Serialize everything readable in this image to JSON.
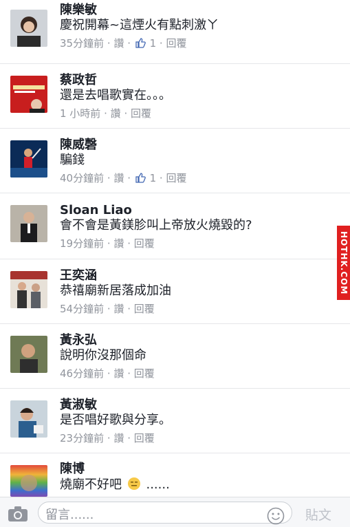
{
  "comments": [
    {
      "name": "陳樂敏",
      "text": "慶祝開幕~這煙火有點刺激ㄚ",
      "time": "35分鐘前",
      "like": "讚",
      "like_count": "1",
      "reply": "回覆",
      "avatar": "person-photo"
    },
    {
      "name": "蔡政哲",
      "text": "還是去唱歌實在。。。",
      "time": "1 小時前",
      "like": "讚",
      "like_count": "",
      "reply": "回覆",
      "avatar": "book-cover-photo"
    },
    {
      "name": "陳威磬",
      "text": "騙錢",
      "time": "40分鐘前",
      "like": "讚",
      "like_count": "1",
      "reply": "回覆",
      "avatar": "tennis-player-photo"
    },
    {
      "name": "Sloan Liao",
      "text": "會不會是黃鎂胗叫上帝放火燒毀的?",
      "time": "19分鐘前",
      "like": "讚",
      "like_count": "",
      "reply": "回覆",
      "avatar": "man-in-suit-photo"
    },
    {
      "name": "王奕涵",
      "text": "恭禧廟新居落成加油",
      "time": "54分鐘前",
      "like": "讚",
      "like_count": "",
      "reply": "回覆",
      "avatar": "people-photo"
    },
    {
      "name": "黃永弘",
      "text": "說明你沒那個命",
      "time": "46分鐘前",
      "like": "讚",
      "like_count": "",
      "reply": "回覆",
      "avatar": "selfie-photo"
    },
    {
      "name": "黃淑敏",
      "text": "是否唱好歌與分享。",
      "time": "23分鐘前",
      "like": "讚",
      "like_count": "",
      "reply": "回覆",
      "avatar": "woman-photo"
    },
    {
      "name": "陳博",
      "text": "燒廟不好吧",
      "text_suffix": "......",
      "time": "",
      "like": "",
      "like_count": "",
      "reply": "",
      "avatar": "rainbow-face-photo"
    }
  ],
  "watermark": "HOTHK.COM",
  "composer": {
    "placeholder": "留言......",
    "post_label": "貼文"
  },
  "colors": {
    "link_gray": "#90949c",
    "like_blue": "#4267b2",
    "watermark_red": "#e02020"
  }
}
